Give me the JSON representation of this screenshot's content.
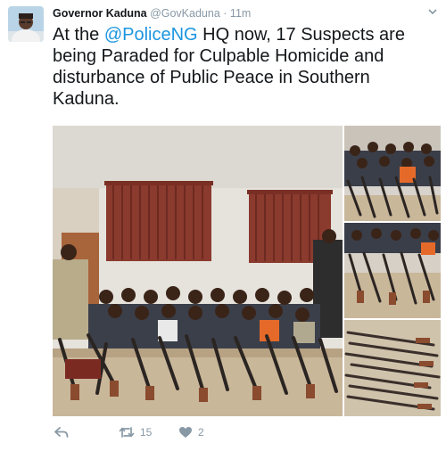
{
  "tweet": {
    "author_name": "Governor Kaduna",
    "author_handle": "@GovKaduna",
    "separator": "·",
    "time": "11m",
    "text_before_mention": "At the ",
    "mention": "@PoliceNG",
    "text_after_mention": " HQ now, 17 Suspects are being Paraded for  Culpable Homicide and disturbance of Public Peace in Southern Kaduna."
  },
  "actions": {
    "reply_icon": "reply-icon",
    "retweet_icon": "retweet-icon",
    "retweet_count": "15",
    "like_icon": "heart-icon",
    "like_count": "2"
  },
  "colors": {
    "text": "#14171a",
    "muted": "#8899a6",
    "link": "#1b95e0"
  }
}
